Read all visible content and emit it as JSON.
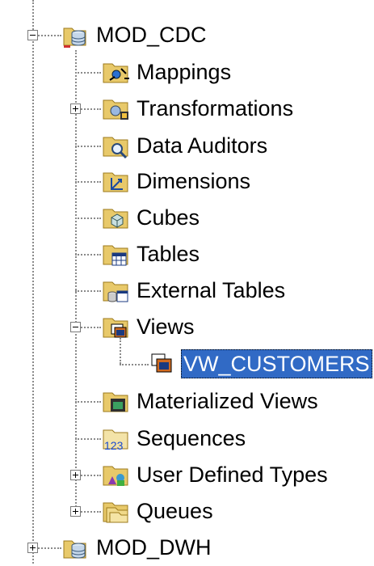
{
  "tree": {
    "module_cdc": {
      "label": "MOD_CDC",
      "icon": "database-module-icon",
      "expanded": true
    },
    "items": [
      {
        "label": "Mappings",
        "icon": "mappings-folder-icon"
      },
      {
        "label": "Transformations",
        "icon": "transformations-folder-icon"
      },
      {
        "label": "Data Auditors",
        "icon": "data-auditors-folder-icon"
      },
      {
        "label": "Dimensions",
        "icon": "dimensions-folder-icon"
      },
      {
        "label": "Cubes",
        "icon": "cubes-folder-icon"
      },
      {
        "label": "Tables",
        "icon": "tables-folder-icon"
      },
      {
        "label": "External Tables",
        "icon": "external-tables-folder-icon"
      },
      {
        "label": "Views",
        "icon": "views-folder-icon"
      },
      {
        "label": "VW_CUSTOMERS",
        "icon": "view-icon",
        "selected": true
      },
      {
        "label": "Materialized Views",
        "icon": "materialized-views-folder-icon"
      },
      {
        "label": "Sequences",
        "icon": "sequences-folder-icon"
      },
      {
        "label": "User Defined Types",
        "icon": "user-defined-types-folder-icon"
      },
      {
        "label": "Queues",
        "icon": "queues-folder-icon"
      }
    ],
    "module_dwh": {
      "label": "MOD_DWH",
      "icon": "database-module-icon",
      "expanded": false
    }
  },
  "colors": {
    "selection": "#316ac5",
    "folder": "#e8c96a",
    "connector": "#8a8a8a"
  }
}
